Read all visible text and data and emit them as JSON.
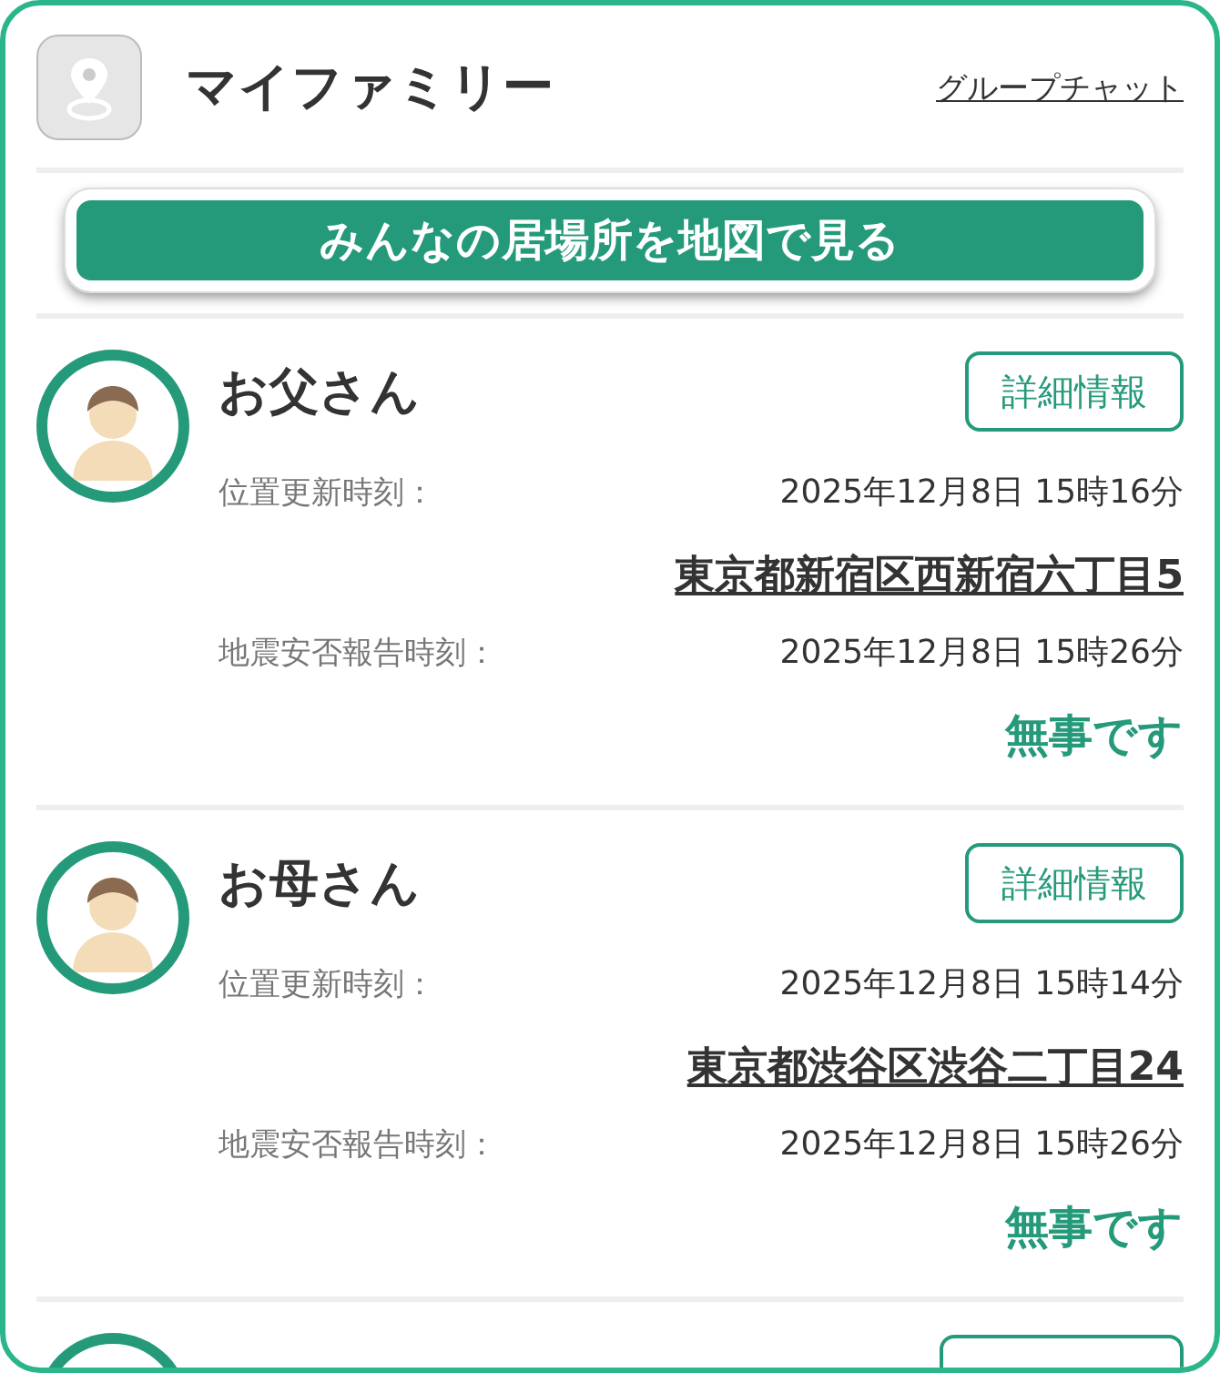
{
  "header": {
    "title": "マイファミリー",
    "chat_link": "グループチャット"
  },
  "map_button": "みんなの居場所を地図で見る",
  "members": [
    {
      "kind": "full",
      "name": "お父さん",
      "detail_button": "詳細情報",
      "location_label": "位置更新時刻：",
      "location_time": "2025年12月8日 15時16分",
      "address": "東京都新宿区西新宿六丁目5",
      "quake_label": "地震安否報告時刻：",
      "quake_time": "2025年12月8日 15時26分",
      "status": "無事です"
    },
    {
      "kind": "full",
      "name": "お母さん",
      "detail_button": "詳細情報",
      "location_label": "位置更新時刻：",
      "location_time": "2025年12月8日 15時14分",
      "address": "東京都渋谷区渋谷二丁目24",
      "quake_label": "地震安否報告時刻：",
      "quake_time": "2025年12月8日 15時26分",
      "status": "無事です"
    },
    {
      "kind": "cut"
    }
  ]
}
